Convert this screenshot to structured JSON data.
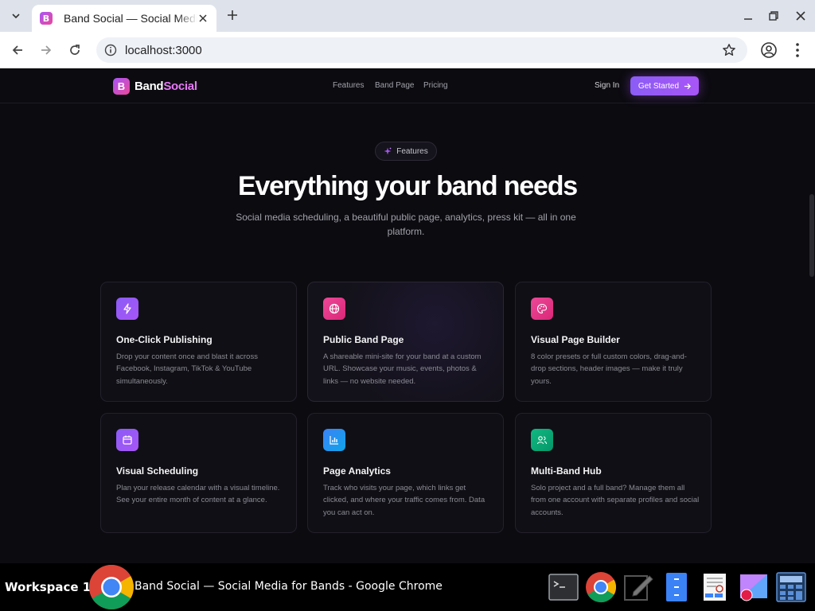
{
  "browser": {
    "tab_title": "Band Social — Social Media for Bands",
    "favicon_letter": "B",
    "url": "localhost:3000"
  },
  "site": {
    "logo_letter": "B",
    "brand_part1": "Band",
    "brand_part2": "Social",
    "nav": [
      "Features",
      "Band Page",
      "Pricing"
    ],
    "sign_in": "Sign In",
    "get_started": "Get Started"
  },
  "hero": {
    "pill": "Features",
    "title": "Everything your band needs",
    "subtitle": "Social media scheduling, a beautiful public page, analytics, press kit — all in one platform."
  },
  "features": [
    {
      "title": "One-Click Publishing",
      "desc": "Drop your content once and blast it across Facebook, Instagram, TikTok & YouTube simultaneously.",
      "icon": "lightning-icon",
      "color": "#8b5cf6"
    },
    {
      "title": "Public Band Page",
      "desc": "A shareable mini-site for your band at a custom URL. Showcase your music, events, photos & links — no website needed.",
      "icon": "globe-icon",
      "color": "#ec4899"
    },
    {
      "title": "Visual Page Builder",
      "desc": "8 color presets or full custom colors, drag-and-drop sections, header images — make it truly yours.",
      "icon": "palette-icon",
      "color": "#ec4899"
    },
    {
      "title": "Visual Scheduling",
      "desc": "Plan your release calendar with a visual timeline. See your entire month of content at a glance.",
      "icon": "calendar-icon",
      "color": "#8b5cf6"
    },
    {
      "title": "Page Analytics",
      "desc": "Track who visits your page, which links get clicked, and where your traffic comes from. Data you can act on.",
      "icon": "bar-chart-icon",
      "color": "#3b82f6"
    },
    {
      "title": "Multi-Band Hub",
      "desc": "Solo project and a full band? Manage them all from one account with separate profiles and social accounts.",
      "icon": "users-icon",
      "color": "#10b981"
    }
  ],
  "taskbar": {
    "workspace": "Workspace 1",
    "window_title": "Band Social — Social Media for Bands - Google Chrome"
  }
}
